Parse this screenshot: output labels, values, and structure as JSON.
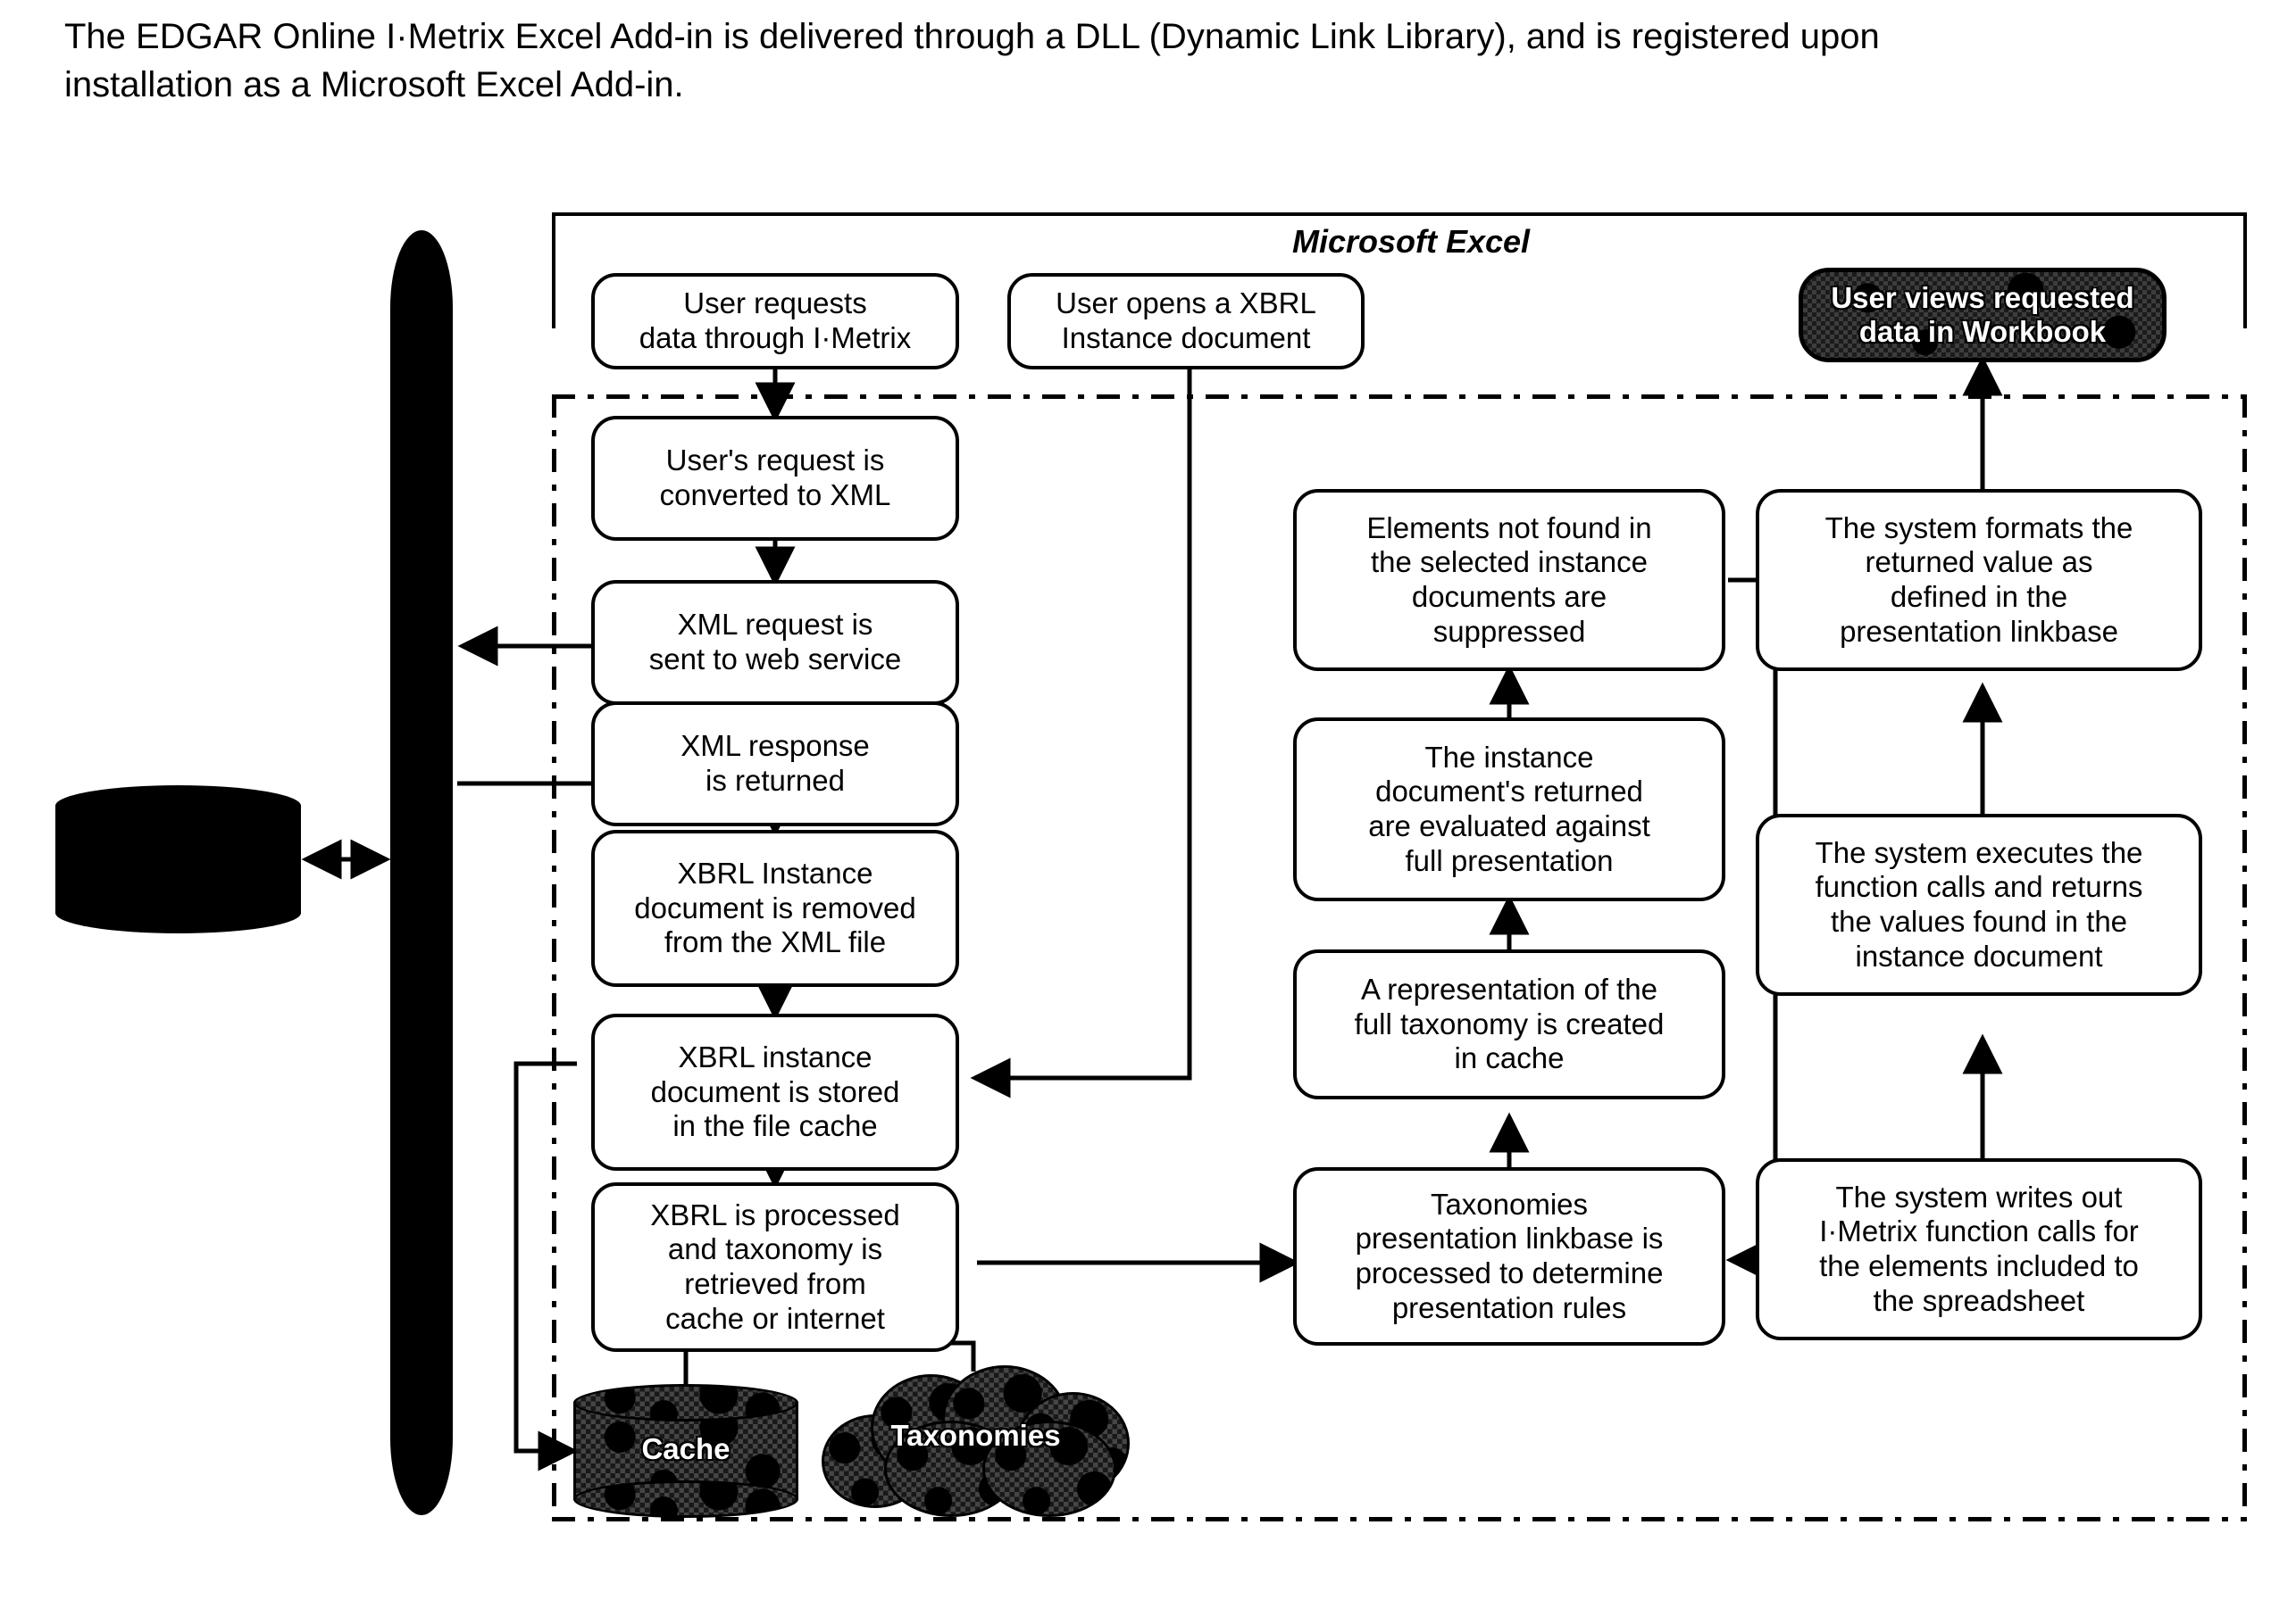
{
  "intro": {
    "text": "The EDGAR Online I·Metrix Excel Add-in is delivered through a DLL (Dynamic Link Library), and is registered upon installation as a Microsoft Excel Add-in."
  },
  "diagram": {
    "excel_panel_title": "Microsoft Excel",
    "excel_boxes": [
      {
        "id": "user-requests",
        "label": "User requests\ndata through I·Metrix"
      },
      {
        "id": "user-opens",
        "label": "User opens a XBRL\nInstance document"
      },
      {
        "id": "user-views",
        "label": "User views requested\ndata in Workbook",
        "style": "shaded"
      }
    ],
    "left_column": [
      {
        "id": "request-to-xml",
        "label": "User's request is\nconverted to XML"
      },
      {
        "id": "xml-request-sent",
        "label": "XML request is\nsent to web service"
      },
      {
        "id": "xml-response",
        "label": "XML response\nis returned"
      },
      {
        "id": "instance-removed",
        "label": "XBRL Instance\ndocument is removed\nfrom the XML file"
      },
      {
        "id": "instance-stored",
        "label": "XBRL instance\ndocument is stored\nin the file cache"
      },
      {
        "id": "xbrl-processed",
        "label": "XBRL is processed\nand taxonomy is\nretrieved from\ncache or internet"
      }
    ],
    "middle_column": [
      {
        "id": "elements-suppressed",
        "label": "Elements not found in\nthe selected instance\ndocuments are\nsuppressed"
      },
      {
        "id": "instance-evaluated",
        "label": "The instance\ndocument's returned\nare evaluated against\nfull presentation"
      },
      {
        "id": "taxonomy-representation",
        "label": "A representation of the\nfull taxonomy is created\nin cache"
      },
      {
        "id": "linkbase-processed",
        "label": "Taxonomies\npresentation linkbase is\nprocessed to determine\npresentation rules"
      }
    ],
    "right_column": [
      {
        "id": "system-formats",
        "label": "The system formats the\nreturned value as\ndefined in the\npresentation linkbase"
      },
      {
        "id": "system-executes",
        "label": "The system executes the\nfunction calls and returns\nthe values found in the\ninstance document"
      },
      {
        "id": "system-writes",
        "label": "The system writes out\nI·Metrix function calls for\nthe elements included to\nthe spreadsheet"
      }
    ],
    "stores": [
      {
        "id": "cache-store",
        "label": "Cache",
        "shape": "cylinder",
        "style": "shaded"
      },
      {
        "id": "taxonomies-store",
        "label": "Taxonomies",
        "shape": "cloud",
        "style": "shaded"
      },
      {
        "id": "database-store",
        "label": "",
        "shape": "cylinder",
        "style": "solid-black"
      },
      {
        "id": "internet-channel",
        "label": "",
        "shape": "ellipse",
        "style": "solid-black"
      }
    ],
    "colors": {
      "stroke": "#000000",
      "fill": "#ffffff",
      "shaded_fill": "#1b1b1b",
      "shaded_text": "#ffffff"
    }
  }
}
